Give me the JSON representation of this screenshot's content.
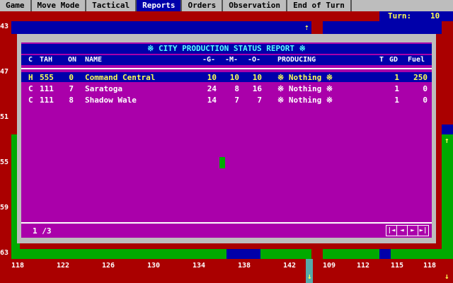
{
  "menu": {
    "items": [
      "Game",
      "Move Mode",
      "Tactical",
      "Reports",
      "Orders",
      "Observation",
      "End of Turn"
    ],
    "active_index": 3
  },
  "turn": {
    "label": "Turn:",
    "value": "10"
  },
  "map": {
    "y_labels": [
      "43",
      "47",
      "51",
      "55",
      "59",
      "63"
    ],
    "x_labels_left": [
      "118",
      "122",
      "126",
      "130",
      "134",
      "138",
      "142"
    ],
    "x_labels_right": [
      "109",
      "112",
      "115",
      "118"
    ]
  },
  "report": {
    "title": "※ CITY PRODUCTION STATUS REPORT ※",
    "headers": {
      "c": "C",
      "tah": "TAH",
      "on": "ON",
      "name": "NAME",
      "g": "-G-",
      "m": "-M-",
      "o": "-O-",
      "producing": "PRODUCING",
      "t": "T",
      "gd": "GD",
      "fuel": "Fuel"
    },
    "rows": [
      {
        "c": "H",
        "tah": "555",
        "on": "0",
        "name": "Command Central",
        "g": "10",
        "m": "10",
        "o": "10",
        "producing": "※ Nothing ※",
        "t": "1",
        "gd": "250"
      },
      {
        "c": "C",
        "tah": "111",
        "on": "7",
        "name": "Saratoga",
        "g": "24",
        "m": "8",
        "o": "16",
        "producing": "※ Nothing ※",
        "t": "1",
        "gd": "0"
      },
      {
        "c": "C",
        "tah": "111",
        "on": "8",
        "name": "Shadow Wale",
        "g": "14",
        "m": "7",
        "o": "7",
        "producing": "※ Nothing ※",
        "t": "1",
        "gd": "0"
      }
    ],
    "selected_row": 0,
    "page": "1  /3",
    "pager_buttons": [
      "|◄",
      "◄",
      "►",
      "►|"
    ]
  }
}
